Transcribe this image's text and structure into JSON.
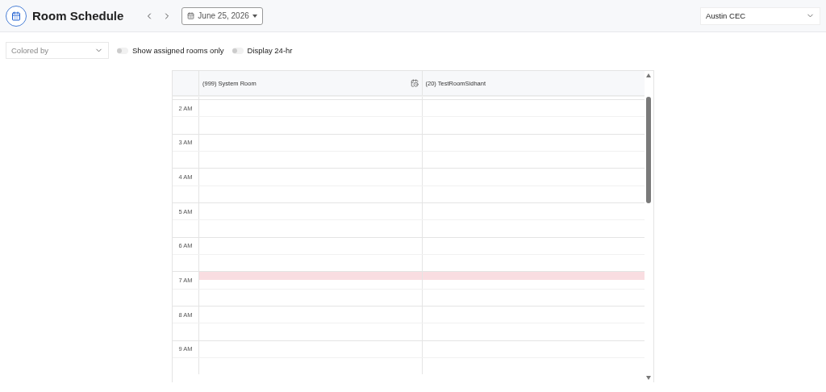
{
  "header": {
    "title": "Room Schedule",
    "date": "June 25, 2026",
    "location": "Austin CEC"
  },
  "filters": {
    "colored_by": {
      "placeholder": "Colored by"
    },
    "toggles": [
      {
        "label": "Show assigned rooms only",
        "on": false
      },
      {
        "label": "Display 24-hr",
        "on": false
      }
    ]
  },
  "schedule": {
    "rooms": [
      {
        "name": "(999) System Room",
        "kind": "with_icon"
      },
      {
        "name": "(20) TestRoomSidhant",
        "kind": "plain"
      }
    ],
    "slots": [
      {
        "kind": "partial"
      },
      {
        "label": "2 AM",
        "highlighted": false
      },
      {
        "highlighted": false
      },
      {
        "label": "3 AM",
        "highlighted": false
      },
      {
        "highlighted": false
      },
      {
        "label": "4 AM",
        "highlighted": false
      },
      {
        "highlighted": false
      },
      {
        "label": "5 AM",
        "highlighted": false
      },
      {
        "highlighted": false
      },
      {
        "label": "6 AM",
        "highlighted": false
      },
      {
        "highlighted": false
      },
      {
        "label": "7 AM",
        "highlighted": true
      },
      {
        "highlighted": false
      },
      {
        "label": "8 AM",
        "highlighted": false
      },
      {
        "highlighted": false
      },
      {
        "label": "9 AM",
        "highlighted": false
      },
      {
        "highlighted": false
      }
    ]
  }
}
